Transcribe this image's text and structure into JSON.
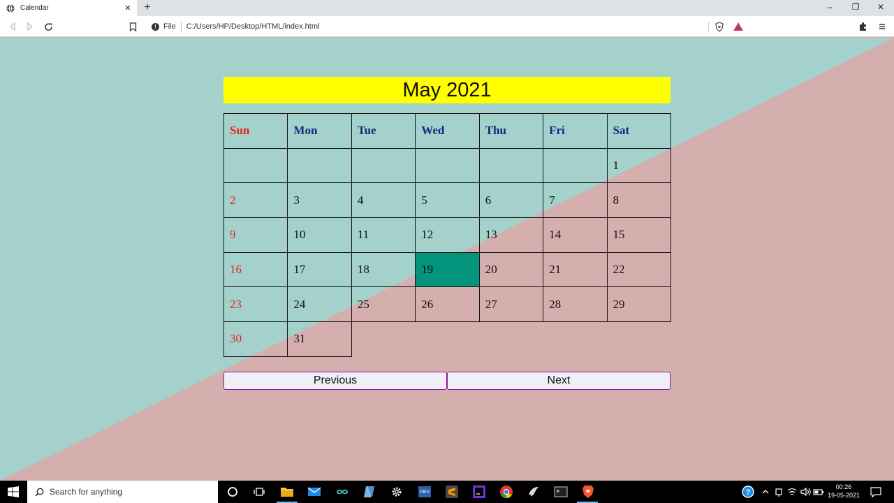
{
  "browser": {
    "tab_title": "Calendar",
    "tab_close": "✕",
    "new_tab": "+",
    "window_controls": [
      "–",
      "❐",
      "✕"
    ],
    "address_scheme": "File",
    "address_url": "C:/Users/HP/Desktop/HTML/index.html"
  },
  "calendar": {
    "header": "May 2021",
    "weekdays": [
      "Sun",
      "Mon",
      "Tue",
      "Wed",
      "Thu",
      "Fri",
      "Sat"
    ],
    "weeks": [
      [
        "",
        "",
        "",
        "",
        "",
        "",
        "1"
      ],
      [
        "2",
        "3",
        "4",
        "5",
        "6",
        "7",
        "8"
      ],
      [
        "9",
        "10",
        "11",
        "12",
        "13",
        "14",
        "15"
      ],
      [
        "16",
        "17",
        "18",
        "19",
        "20",
        "21",
        "22"
      ],
      [
        "23",
        "24",
        "25",
        "26",
        "27",
        "28",
        "29"
      ],
      [
        "30",
        "31"
      ]
    ],
    "today": "19",
    "colors": {
      "header_bg": "#ffff00",
      "sunday": "#e5221f",
      "weekday_header": "#14277f",
      "today_bg": "#02957c",
      "bg_teal": "#a4d1cb",
      "bg_pink": "#d5aeae"
    }
  },
  "buttons": {
    "previous": "Previous",
    "next": "Next"
  },
  "taskbar": {
    "search_placeholder": "Search for anything",
    "icons": [
      "windows-start-icon",
      "cortana-icon",
      "task-view-icon",
      "file-explorer-icon",
      "mail-icon",
      "arduino-icon",
      "notepad-icon",
      "settings-icon",
      "devc-icon",
      "sublime-icon",
      "intellij-icon",
      "chrome-icon",
      "inkscape-icon",
      "terminal-icon",
      "brave-icon"
    ],
    "time": "00:26",
    "date": "19-05-2021"
  }
}
